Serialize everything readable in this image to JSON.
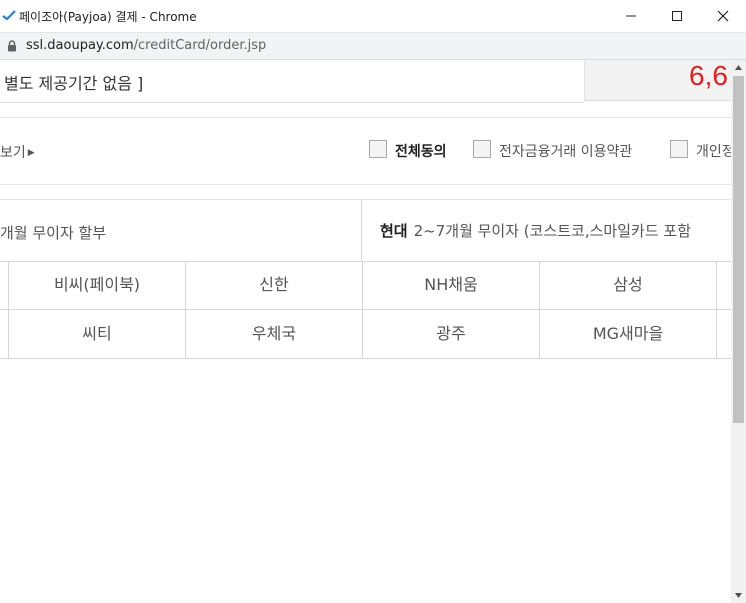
{
  "window": {
    "title": "페이조아(Payjoa) 결제 - Chrome",
    "controls": {
      "minimize": "minimize-icon",
      "maximize": "maximize-icon",
      "close": "close-icon"
    }
  },
  "addressbar": {
    "url_domain": "ssl.daoupay.com",
    "url_path": "/creditCard/order.jsp"
  },
  "notice": {
    "text": "별도 제공기간 없음 ]"
  },
  "amount": {
    "text": "6,6"
  },
  "agreements": {
    "view_link": "보기",
    "all_agree": "전체동의",
    "items": [
      "전자금융거래 이용약관",
      "개인정"
    ]
  },
  "promo": {
    "left_text": "개월 무이자 할부",
    "right_card": "현대",
    "right_text": "2~7개월 무이자 (코스트코,스마일카드 포함"
  },
  "cards": {
    "row1": [
      "",
      "비씨(페이북)",
      "신한",
      "NH채움",
      "삼성",
      ""
    ],
    "row2": [
      "",
      "씨티",
      "우체국",
      "광주",
      "MG새마을",
      ""
    ]
  },
  "colors": {
    "amount": "#e12020",
    "border": "#d6d6d6",
    "scroll_thumb": "#c1c1c1"
  }
}
